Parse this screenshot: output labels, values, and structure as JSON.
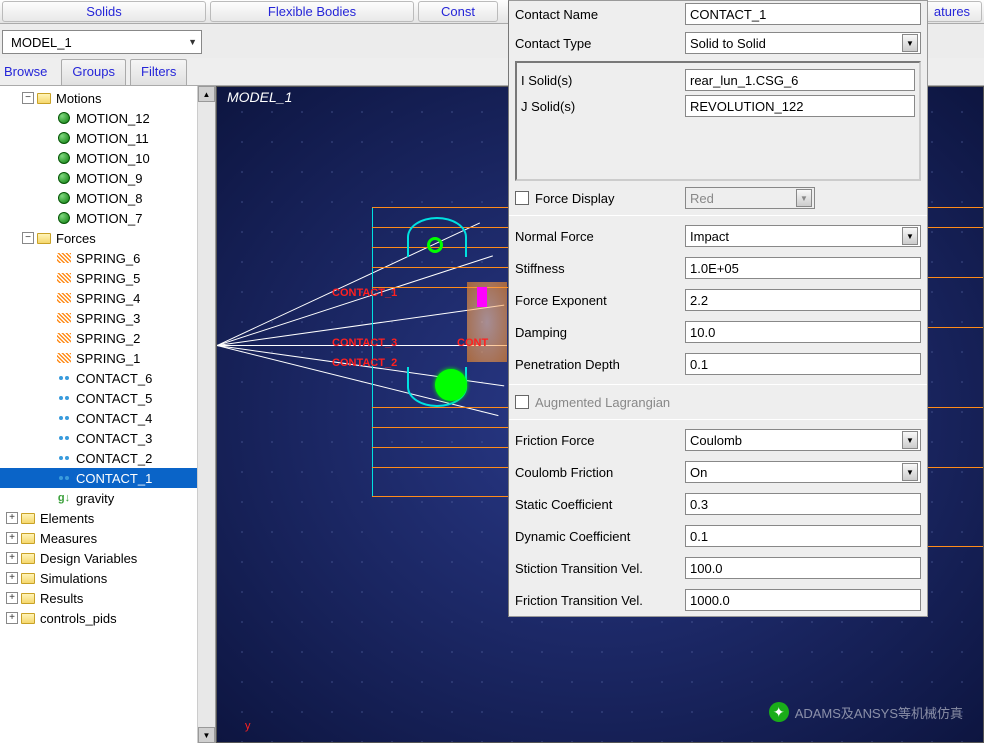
{
  "toolbar": {
    "solids": "Solids",
    "flexible": "Flexible Bodies",
    "const": "Const",
    "features": "atures"
  },
  "model_select": "MODEL_1",
  "tabs": {
    "browse": "Browse",
    "groups": "Groups",
    "filters": "Filters"
  },
  "tree": {
    "motions": {
      "label": "Motions",
      "items": [
        "MOTION_12",
        "MOTION_11",
        "MOTION_10",
        "MOTION_9",
        "MOTION_8",
        "MOTION_7"
      ]
    },
    "forces": {
      "label": "Forces",
      "springs": [
        "SPRING_6",
        "SPRING_5",
        "SPRING_4",
        "SPRING_3",
        "SPRING_2",
        "SPRING_1"
      ],
      "contacts": [
        "CONTACT_6",
        "CONTACT_5",
        "CONTACT_4",
        "CONTACT_3",
        "CONTACT_2",
        "CONTACT_1"
      ],
      "gravity": "gravity"
    },
    "bottom": [
      "Elements",
      "Measures",
      "Design Variables",
      "Simulations",
      "Results",
      "controls_pids"
    ]
  },
  "viewport": {
    "title": "MODEL_1",
    "labels": {
      "c1": "CONTACT_1",
      "c3": "CONTACT_3",
      "cont": "CONT",
      "other": "CONTACT_2"
    },
    "watermark": "ADAMS及ANSYS等机械仿真",
    "axis_y": "y"
  },
  "props": {
    "contact_name": {
      "label": "Contact Name",
      "value": "CONTACT_1"
    },
    "contact_type": {
      "label": "Contact Type",
      "value": "Solid to Solid"
    },
    "i_solid": {
      "label": "I Solid(s)",
      "value": "rear_lun_1.CSG_6"
    },
    "j_solid": {
      "label": "J Solid(s)",
      "value": "REVOLUTION_122"
    },
    "force_display": {
      "label": "Force Display",
      "value": "Red"
    },
    "normal_force": {
      "label": "Normal Force",
      "value": "Impact"
    },
    "stiffness": {
      "label": "Stiffness",
      "value": "1.0E+05"
    },
    "force_exponent": {
      "label": "Force Exponent",
      "value": "2.2"
    },
    "damping": {
      "label": "Damping",
      "value": "10.0"
    },
    "penetration": {
      "label": "Penetration Depth",
      "value": "0.1"
    },
    "aug_lagrangian": "Augmented Lagrangian",
    "friction_force": {
      "label": "Friction Force",
      "value": "Coulomb"
    },
    "coulomb_friction": {
      "label": "Coulomb Friction",
      "value": "On"
    },
    "static_coef": {
      "label": "Static Coefficient",
      "value": "0.3"
    },
    "dynamic_coef": {
      "label": "Dynamic Coefficient",
      "value": "0.1"
    },
    "stiction_vel": {
      "label": "Stiction Transition Vel.",
      "value": "100.0"
    },
    "friction_vel": {
      "label": "Friction Transition Vel.",
      "value": "1000.0"
    }
  }
}
